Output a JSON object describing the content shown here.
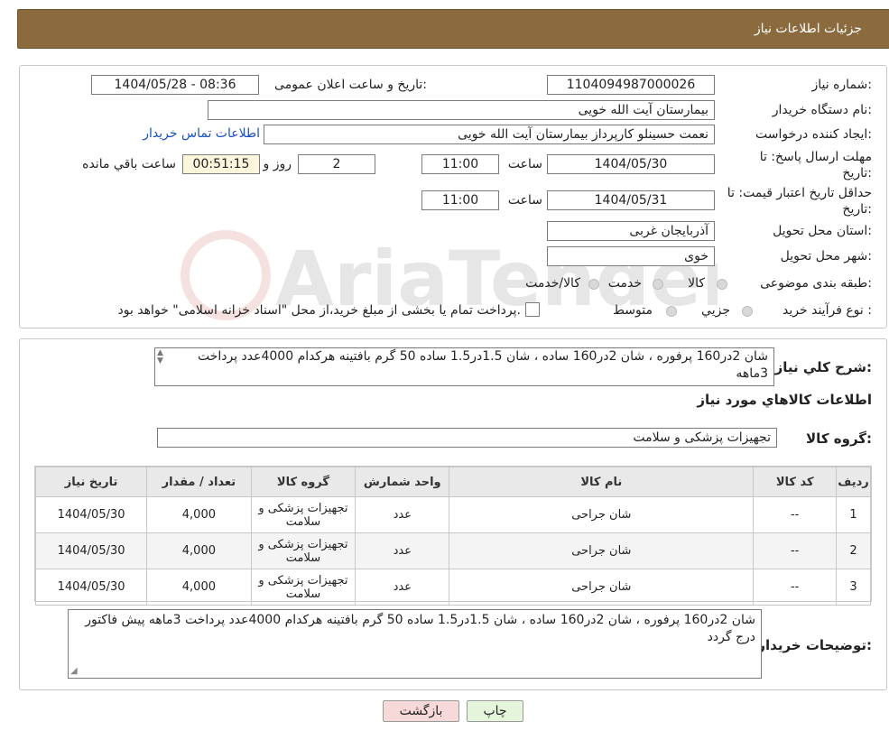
{
  "header": {
    "title": "جزئیات اطلاعات نیاز"
  },
  "form": {
    "need_number_label": "شماره نیاز:",
    "need_number": "1104094987000026",
    "announce_label": "تاریخ و ساعت اعلان عمومی:",
    "announce_value": "1404/05/28 - 08:36",
    "buyer_label": "نام دستگاه خریدار:",
    "buyer_value": "بیمارستان آیت الله خویی",
    "creator_label": "ایجاد کننده درخواست:",
    "creator_value": "نعمت حسینلو کارپرداز بیمارستان آیت الله خویی",
    "contact_link": "اطلاعات تماس خریدار",
    "reply_deadline_label_1": "مهلت ارسال پاسخ: تا",
    "reply_deadline_label_2": "تاریخ:",
    "reply_date": "1404/05/30",
    "time_label": "ساعت",
    "reply_time": "11:00",
    "days_value": "2",
    "days_label": "روز و",
    "remaining_time": "00:51:15",
    "remaining_label": "ساعت باقي مانده",
    "price_validity_label_1": "حداقل تاریخ اعتبار قیمت: تا",
    "price_validity_label_2": "تاریخ:",
    "price_date": "1404/05/31",
    "price_time": "11:00",
    "province_label": "استان محل تحویل:",
    "province_value": "آذربایجان غربی",
    "city_label": "شهر محل تحویل:",
    "city_value": "خوی",
    "category_label": "طبقه بندی موضوعی:",
    "category_options": [
      "کالا",
      "خدمت",
      "کالا/خدمت"
    ],
    "process_label": "نوع فرآیند خرید :",
    "process_options": [
      "جزیي",
      "متوسط"
    ],
    "process_note": "پرداخت تمام یا بخشی از مبلغ خرید،از محل \"اسناد خزانه اسلامی\" خواهد بود."
  },
  "summary": {
    "label": "شرح کلي نیاز:",
    "text": "شان 2در160  پرفوره ، شان 2در160 ساده ، شان 1.5در1.5 ساده 50 گرم بافتینه  هرکدام 4000عدد پرداخت 3ماهه",
    "items_title": "اطلاعات کالاهاي مورد نیاز",
    "group_label": "گروه کالا:",
    "group_value": "تجهیزات پزشکی و سلامت"
  },
  "table": {
    "headers": [
      "ردیف",
      "کد کالا",
      "نام کالا",
      "واحد شمارش",
      "گروه کالا",
      "تعداد / مقدار",
      "تاریخ نیاز"
    ],
    "rows": [
      [
        "1",
        "--",
        "شان جراحی",
        "عدد",
        "تجهیزات پزشکی و سلامت",
        "4,000",
        "1404/05/30"
      ],
      [
        "2",
        "--",
        "شان جراحی",
        "عدد",
        "تجهیزات پزشکی و سلامت",
        "4,000",
        "1404/05/30"
      ],
      [
        "3",
        "--",
        "شان جراحی",
        "عدد",
        "تجهیزات پزشکی و سلامت",
        "4,000",
        "1404/05/30"
      ]
    ]
  },
  "buyer_notes": {
    "label": "توضیحات خریدار:",
    "text": "شان 2در160  پرفوره ، شان 2در160 ساده ، شان 1.5در1.5 ساده 50 گرم بافتینه  هرکدام 4000عدد پرداخت 3ماهه پیش فاکتور درج گردد"
  },
  "buttons": {
    "print": "چاپ",
    "back": "بازگشت"
  },
  "watermark_text": "AriaTender.neT",
  "colors": {
    "header_bg": "#8b6b3d",
    "link": "#1a4fc4",
    "back_button_bg": "#f8d9d9",
    "print_button_bg": "#e4f5dc",
    "remaining_bg": "#fbf6dc"
  }
}
